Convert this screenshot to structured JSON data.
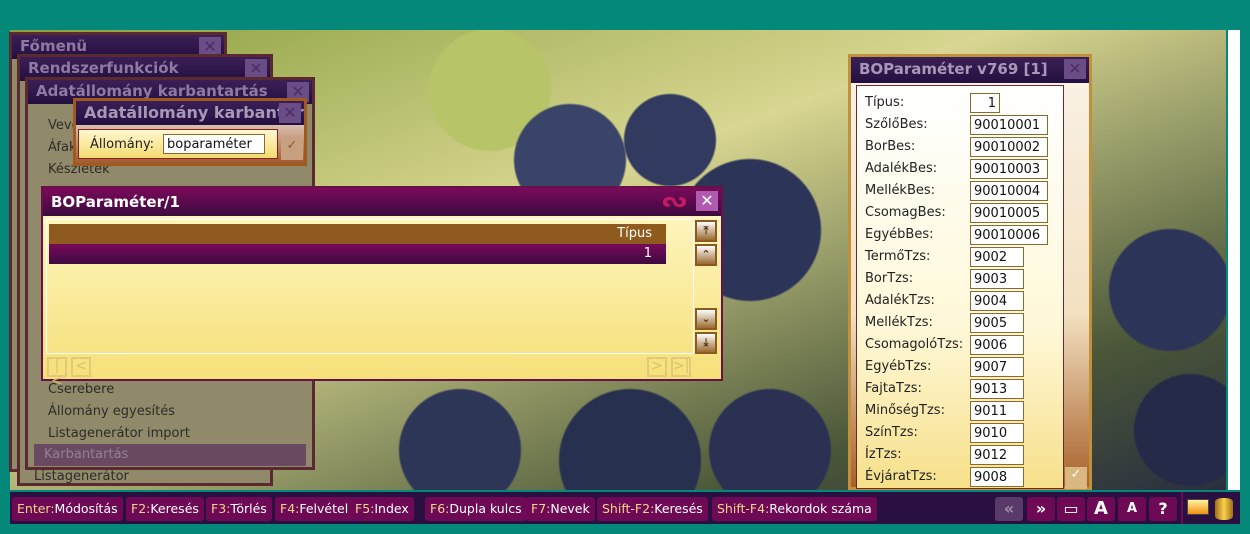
{
  "windows": {
    "main_menu": {
      "title": "Főmenü"
    },
    "system": {
      "title": "Rendszerfunkciók"
    },
    "maint": {
      "title": "Adatállomány karbantartás",
      "items": [
        "Vevők",
        "Áfakódok",
        "Készletek",
        "Cserebere",
        "Állomány egyesítés",
        "Listagenerátor import",
        "Karbantartás"
      ],
      "behind_item": "Listagenerátor"
    },
    "file_dialog": {
      "title": "Adatállomány karbantartás",
      "label": "Állomány:",
      "value": "boparaméter"
    },
    "browse": {
      "title": "BOParaméter/1",
      "column": "Típus",
      "rows": [
        "1"
      ]
    },
    "record": {
      "title": "BOParaméter v769 [1]",
      "fields": [
        {
          "label": "Típus:",
          "value": "1"
        },
        {
          "label": "SzőlőBes:",
          "value": "90010001"
        },
        {
          "label": "BorBes:",
          "value": "90010002"
        },
        {
          "label": "AdalékBes:",
          "value": "90010003"
        },
        {
          "label": "MellékBes:",
          "value": "90010004"
        },
        {
          "label": "CsomagBes:",
          "value": "90010005"
        },
        {
          "label": "EgyébBes:",
          "value": "90010006"
        },
        {
          "label": "TermőTzs:",
          "value": "9002"
        },
        {
          "label": "BorTzs:",
          "value": "9003"
        },
        {
          "label": "AdalékTzs:",
          "value": "9004"
        },
        {
          "label": "MellékTzs:",
          "value": "9005"
        },
        {
          "label": "CsomagolóTzs:",
          "value": "9006"
        },
        {
          "label": "EgyébTzs:",
          "value": "9007"
        },
        {
          "label": "FajtaTzs:",
          "value": "9013"
        },
        {
          "label": "MinőségTzs:",
          "value": "9011"
        },
        {
          "label": "SzínTzs:",
          "value": "9010"
        },
        {
          "label": "ÍzTzs:",
          "value": "9012"
        },
        {
          "label": "ÉvjáratTzs:",
          "value": "9008"
        }
      ]
    }
  },
  "fkeys": [
    {
      "key": "Enter:",
      "label": "Módosítás"
    },
    {
      "key": "F2:",
      "label": "Keresés"
    },
    {
      "key": "F3:",
      "label": "Törlés"
    },
    {
      "key": "F4:",
      "label": "Felvétel"
    },
    {
      "key": "F5:",
      "label": "Index"
    },
    {
      "key": "F6:",
      "label": "Dupla kulcs"
    },
    {
      "key": "F7:",
      "label": "Nevek"
    },
    {
      "key": "Shift-F2:",
      "label": "Keresés"
    },
    {
      "key": "Shift-F4:",
      "label": "Rekordok száma"
    }
  ],
  "toolbar": {
    "help": "?",
    "font_large": "A",
    "font_small": "A"
  }
}
